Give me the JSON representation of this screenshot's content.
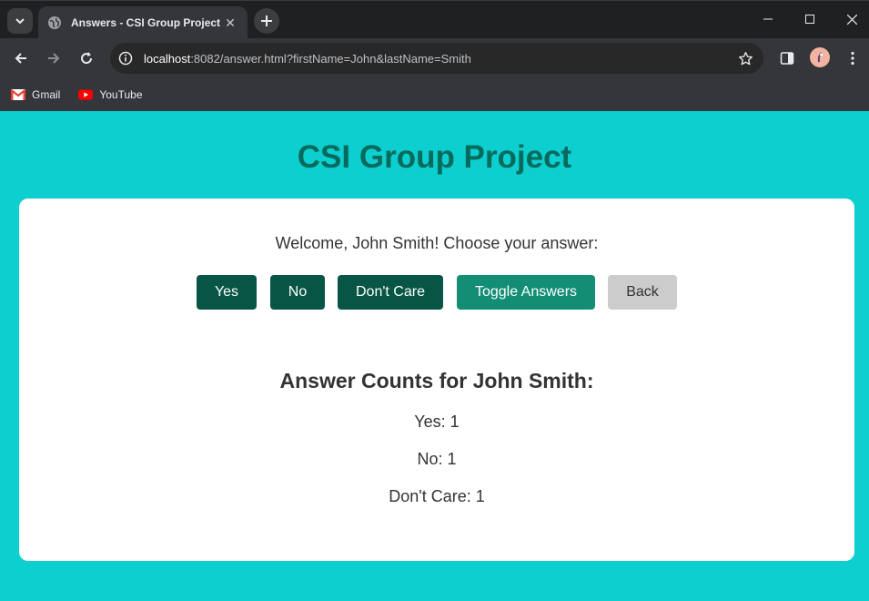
{
  "browser": {
    "tab_title": "Answers - CSI Group Project",
    "url_host": "localhost",
    "url_rest": ":8082/answer.html?firstName=John&lastName=Smith",
    "bookmarks": [
      {
        "label": "Gmail",
        "icon": "gmail-icon"
      },
      {
        "label": "YouTube",
        "icon": "youtube-icon"
      }
    ],
    "colors": {
      "chrome_dark": "#1f2021",
      "chrome": "#35363a"
    }
  },
  "page": {
    "title": "CSI Group Project",
    "welcome": "Welcome, John Smith! Choose your answer:",
    "buttons": {
      "yes": "Yes",
      "no": "No",
      "dont_care": "Don't Care",
      "toggle": "Toggle Answers",
      "back": "Back"
    },
    "counts_title": "Answer Counts for John Smith:",
    "counts": {
      "yes": "Yes: 1",
      "no": "No: 1",
      "dont_care": "Don't Care: 1"
    },
    "colors": {
      "background": "#0ecfcf",
      "title": "#066a5d",
      "button_dark": "#075645",
      "button_teal": "#138e74",
      "button_gray": "#cccccc"
    }
  }
}
